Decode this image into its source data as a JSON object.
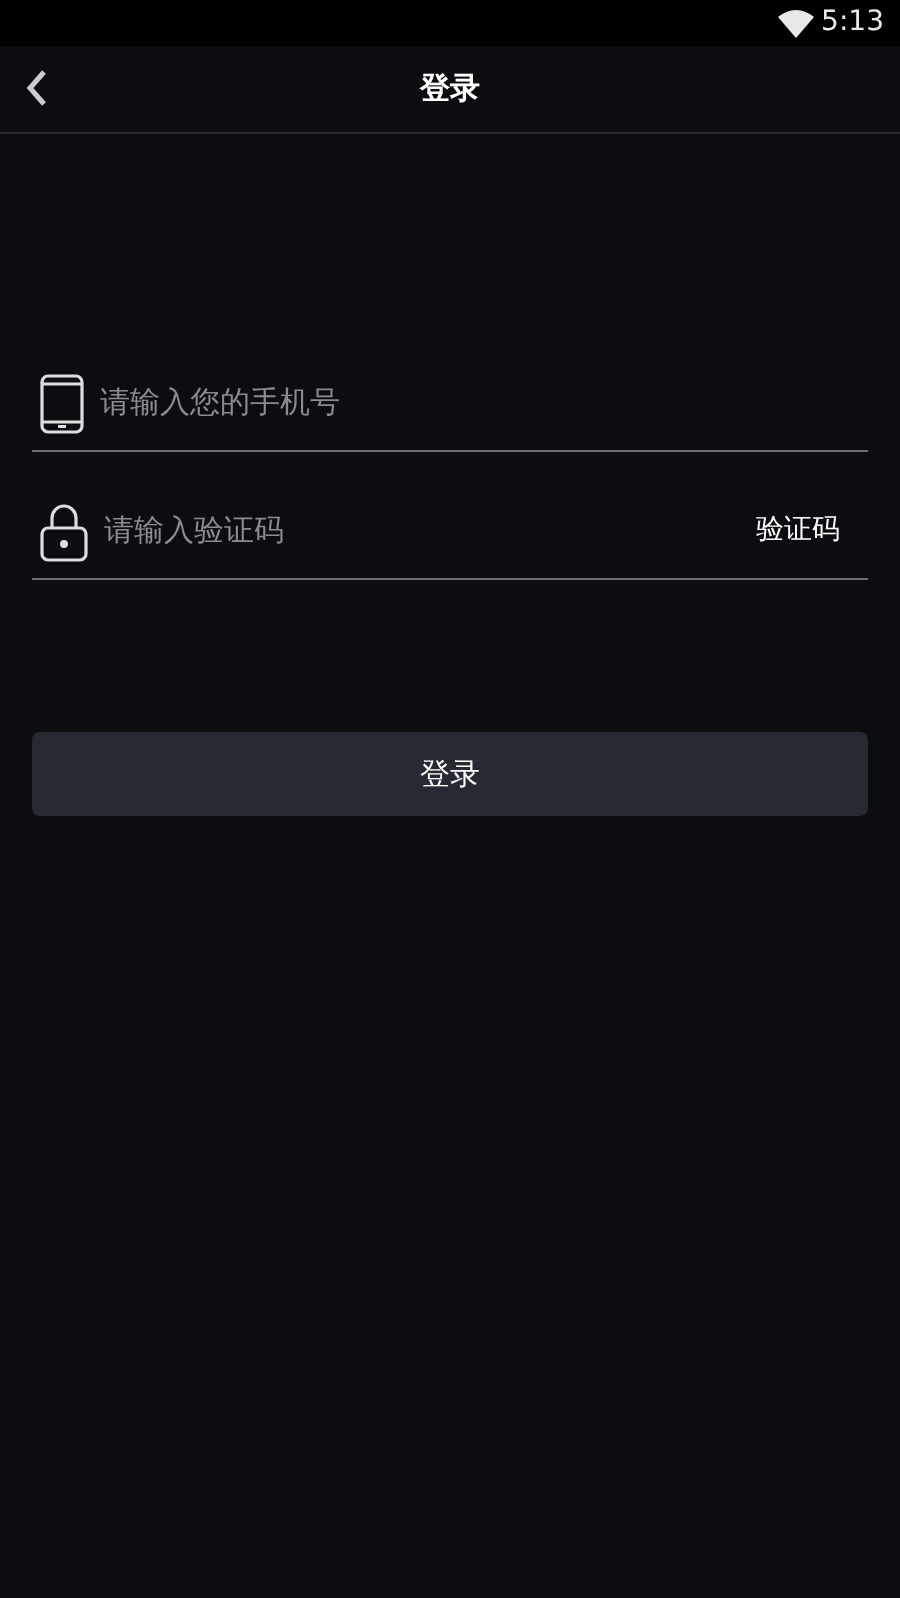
{
  "status_bar": {
    "time": "5:13"
  },
  "header": {
    "title": "登录"
  },
  "form": {
    "phone": {
      "placeholder": "请输入您的手机号"
    },
    "code": {
      "placeholder": "请输入验证码",
      "send_label": "验证码"
    }
  },
  "submit": {
    "label": "登录"
  }
}
